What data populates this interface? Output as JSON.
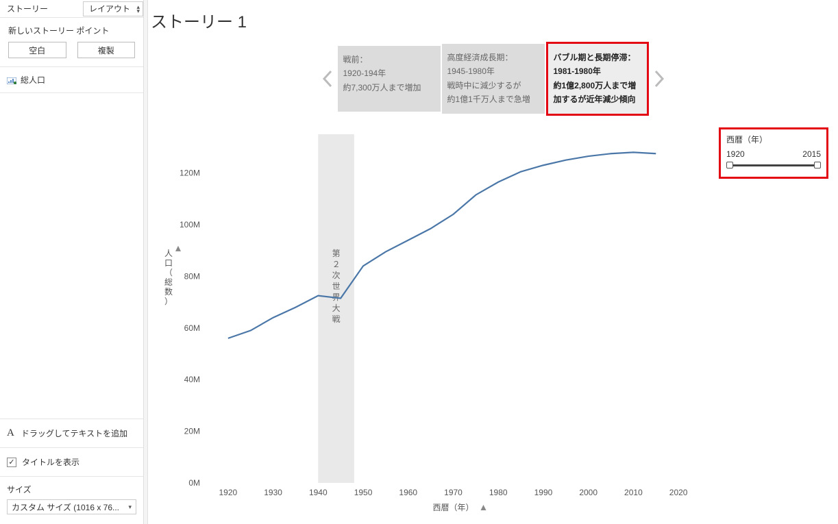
{
  "sidebar": {
    "tab_story": "ストーリー",
    "tab_layout": "レイアウト",
    "new_point": "新しいストーリー ポイント",
    "btn_blank": "空白",
    "btn_duplicate": "複製",
    "sheet_item": "総人口",
    "drag_text": "ドラッグしてテキストを追加",
    "drag_text_icon": "A",
    "show_title": "タイトルを表示",
    "size_label": "サイズ",
    "size_value": "カスタム サイズ (1016 x 76..."
  },
  "story": {
    "title": "ストーリー 1",
    "captions": [
      {
        "line1": "戦前：",
        "line2": "1920-194年",
        "line3": "約7,300万人まで増加",
        "line4": ""
      },
      {
        "line1": "高度経済成長期：",
        "line2": "1945-1980年",
        "line3": "戦時中に減少するが",
        "line4": "約1億1千万人まで急増"
      },
      {
        "line1": "バブル期と長期停滞：",
        "line2": "1981-1980年",
        "line3": "約1億2,800万人まで増",
        "line4": "加するが近年減少傾向"
      }
    ]
  },
  "filter": {
    "title": "西暦（年）",
    "from": "1920",
    "to": "2015"
  },
  "chart": {
    "ylabel": "人口（総数）",
    "xlabel": "西暦（年）",
    "band_label": "第２次世界大戦",
    "yticks": [
      "0M",
      "20M",
      "40M",
      "60M",
      "80M",
      "100M",
      "120M"
    ],
    "xticks": [
      "1920",
      "1930",
      "1940",
      "1950",
      "1960",
      "1970",
      "1980",
      "1990",
      "2000",
      "2010",
      "2020"
    ]
  },
  "chart_data": {
    "type": "line",
    "title": "",
    "xlabel": "西暦（年）",
    "ylabel": "人口（総数）",
    "xlim": [
      1915,
      2025
    ],
    "ylim": [
      0,
      135
    ],
    "unit": "M",
    "band": {
      "from": 1940,
      "to": 1948,
      "label": "第２次世界大戦"
    },
    "series": [
      {
        "name": "総人口",
        "x": [
          1920,
          1925,
          1930,
          1935,
          1940,
          1945,
          1950,
          1955,
          1960,
          1965,
          1970,
          1975,
          1980,
          1985,
          1990,
          1995,
          2000,
          2005,
          2010,
          2015
        ],
        "y": [
          56,
          59,
          64,
          68,
          72.5,
          71.5,
          84,
          89.5,
          94,
          98.5,
          104,
          111.5,
          116.5,
          120.5,
          123,
          125,
          126.5,
          127.5,
          128,
          127.5
        ]
      }
    ]
  }
}
